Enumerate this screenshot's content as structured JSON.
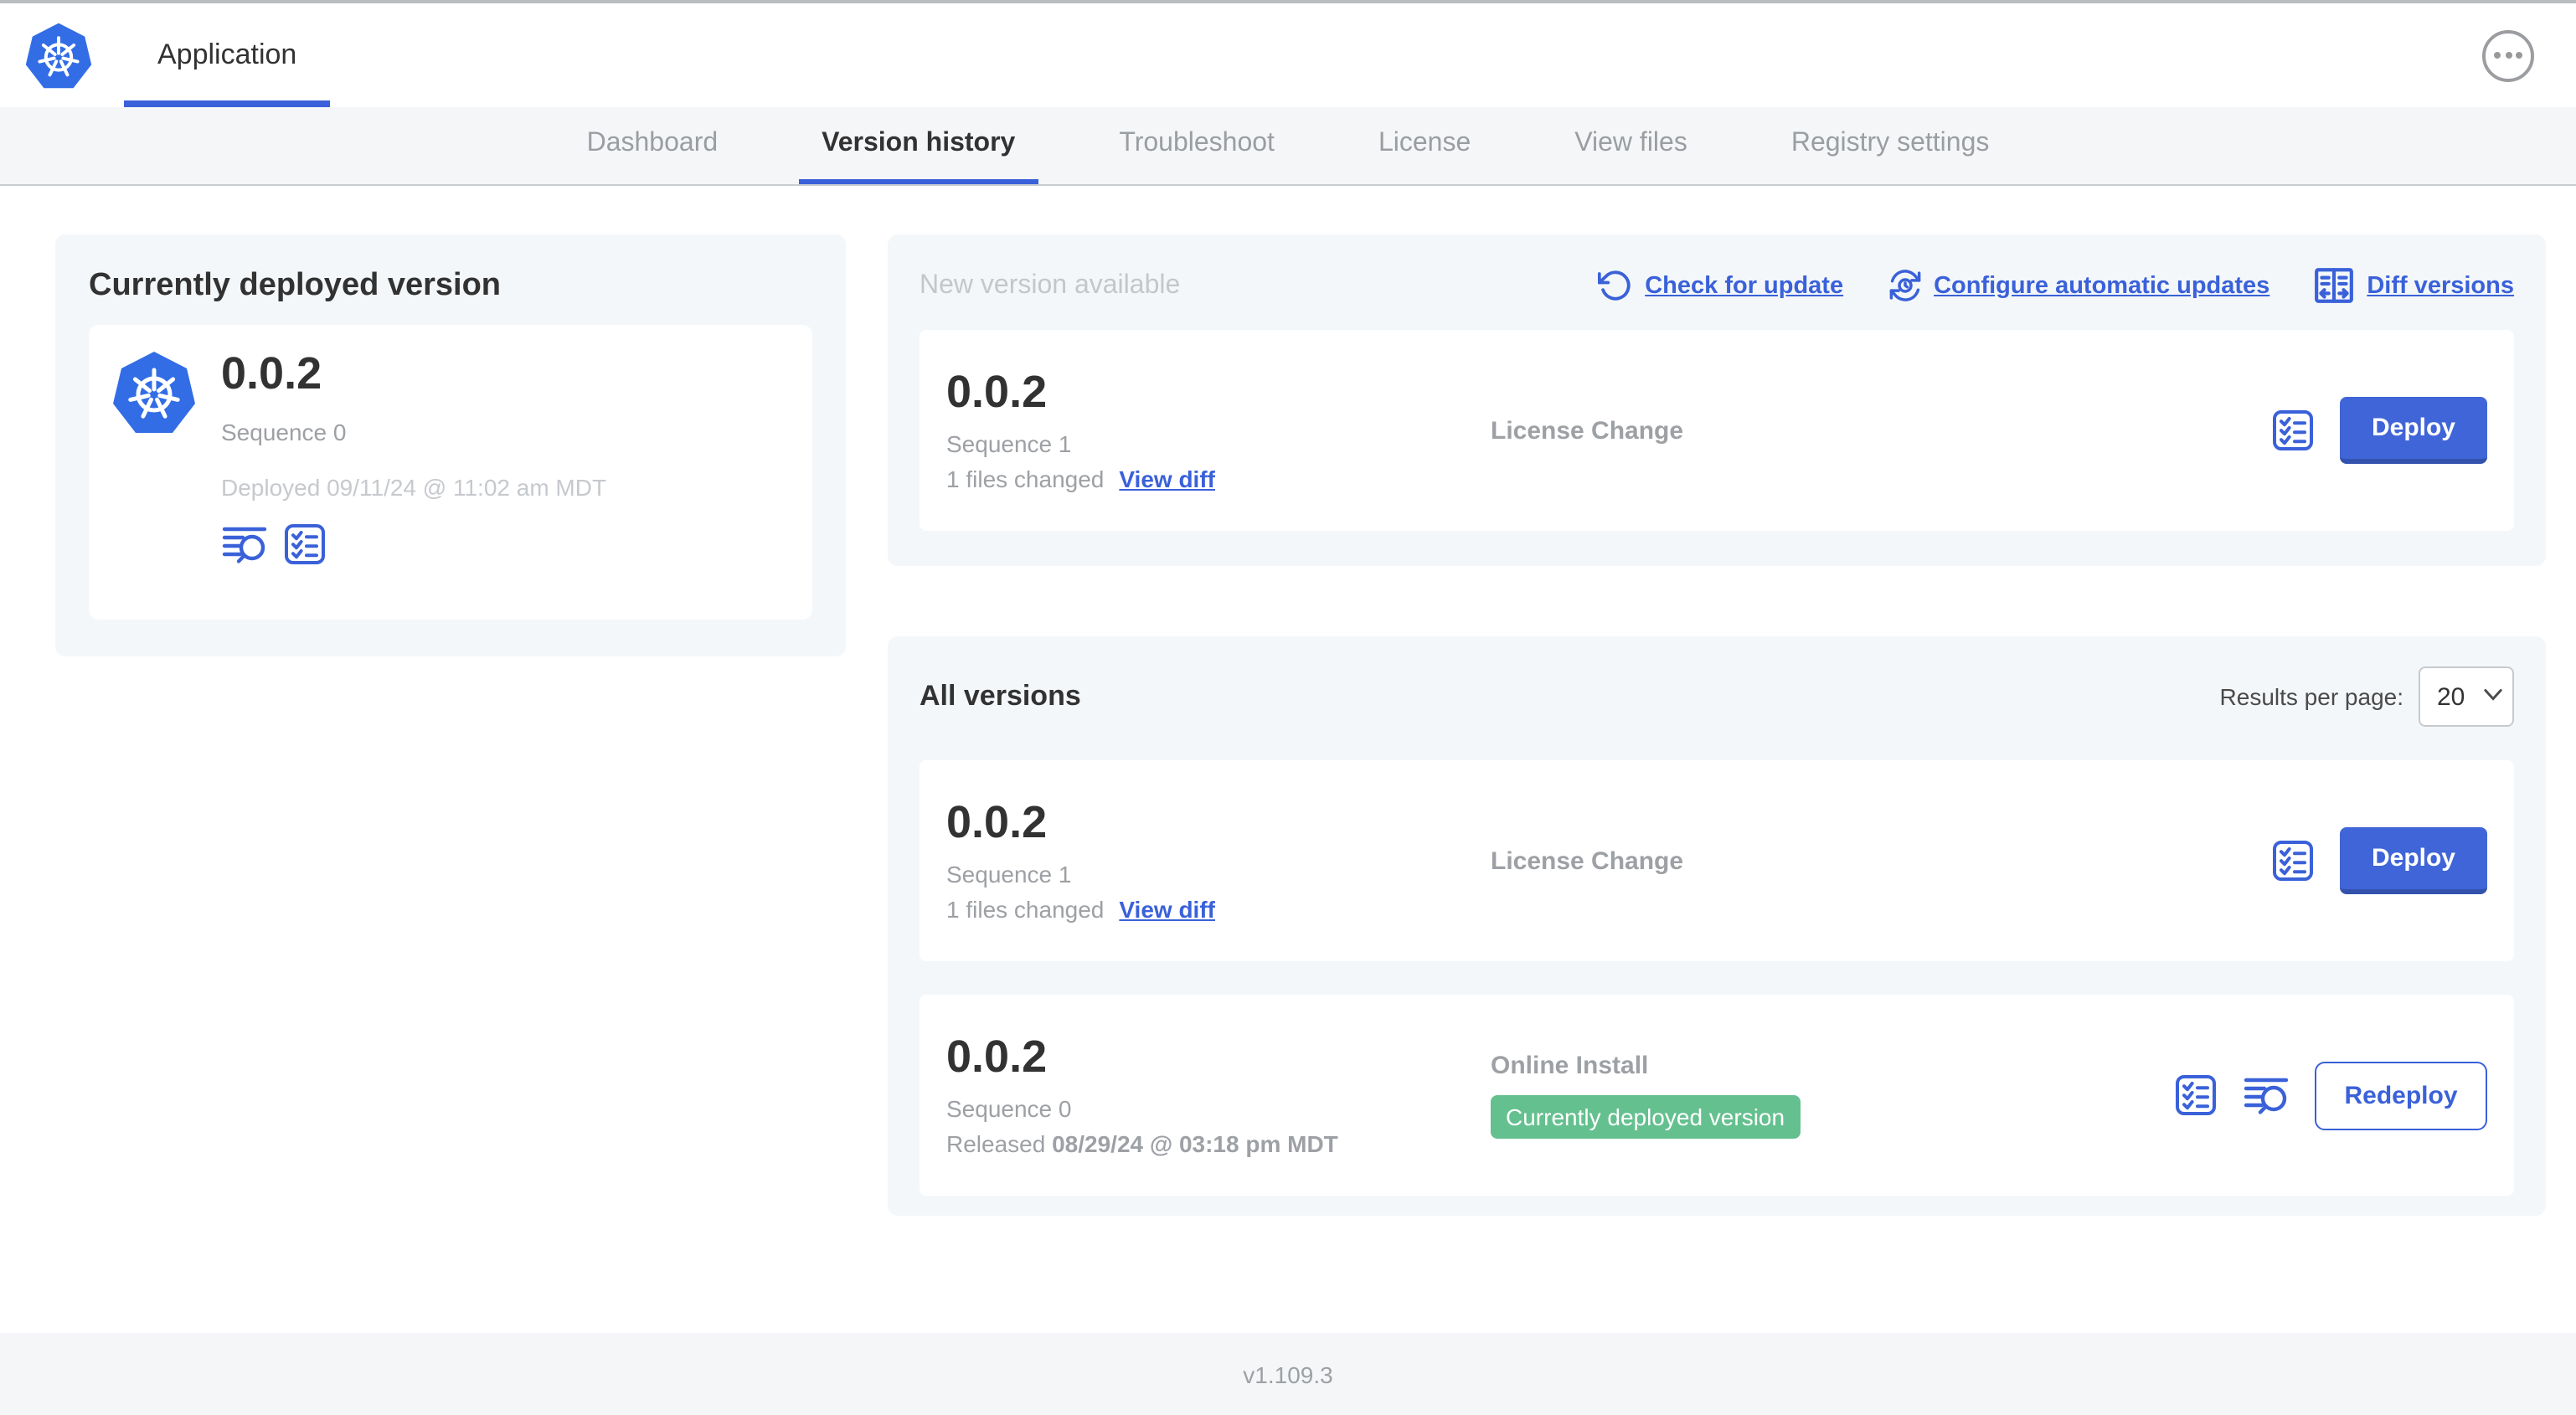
{
  "colors": {
    "accent_blue": "#3a61d9",
    "button_blue": "#4065d8",
    "button_blue_shadow": "#3352ae",
    "badge_green": "#65c08f",
    "logo_blue": "#326de6",
    "panel_gray": "#f4f7f9"
  },
  "header": {
    "app_tab": "Application",
    "menu_icon": "ellipsis-menu-icon"
  },
  "nav": {
    "tabs": [
      {
        "label": "Dashboard",
        "active": false
      },
      {
        "label": "Version history",
        "active": true
      },
      {
        "label": "Troubleshoot",
        "active": false
      },
      {
        "label": "License",
        "active": false
      },
      {
        "label": "View files",
        "active": false
      },
      {
        "label": "Registry settings",
        "active": false
      }
    ]
  },
  "current_deployed": {
    "title": "Currently deployed version",
    "version": "0.0.2",
    "sequence": "Sequence 0",
    "deployed": "Deployed 09/11/24 @ 11:02 am MDT",
    "icons": [
      "view-logs-icon",
      "preflight-checks-icon"
    ]
  },
  "new_version": {
    "title": "New version available",
    "check_for_update": "Check for update",
    "configure_auto_updates": "Configure automatic updates",
    "diff_versions": "Diff versions",
    "card": {
      "version": "0.0.2",
      "sequence": "Sequence 1",
      "files_changed": "1 files changed",
      "view_diff": "View diff",
      "source": "License Change",
      "deploy_label": "Deploy"
    }
  },
  "all_versions": {
    "title": "All versions",
    "results_per_page_label": "Results per page:",
    "results_per_page": "20",
    "rows": [
      {
        "version": "0.0.2",
        "sequence": "Sequence 1",
        "files_changed": "1 files changed",
        "view_diff": "View diff",
        "source": "License Change",
        "deploy_label": "Deploy"
      },
      {
        "version": "0.0.2",
        "sequence": "Sequence 0",
        "released_label": "Released",
        "released_date": "08/29/24 @ 03:18 pm MDT",
        "source": "Online Install",
        "badge": "Currently deployed version",
        "redeploy_label": "Redeploy"
      }
    ]
  },
  "footer": {
    "app_version": "v1.109.3"
  }
}
